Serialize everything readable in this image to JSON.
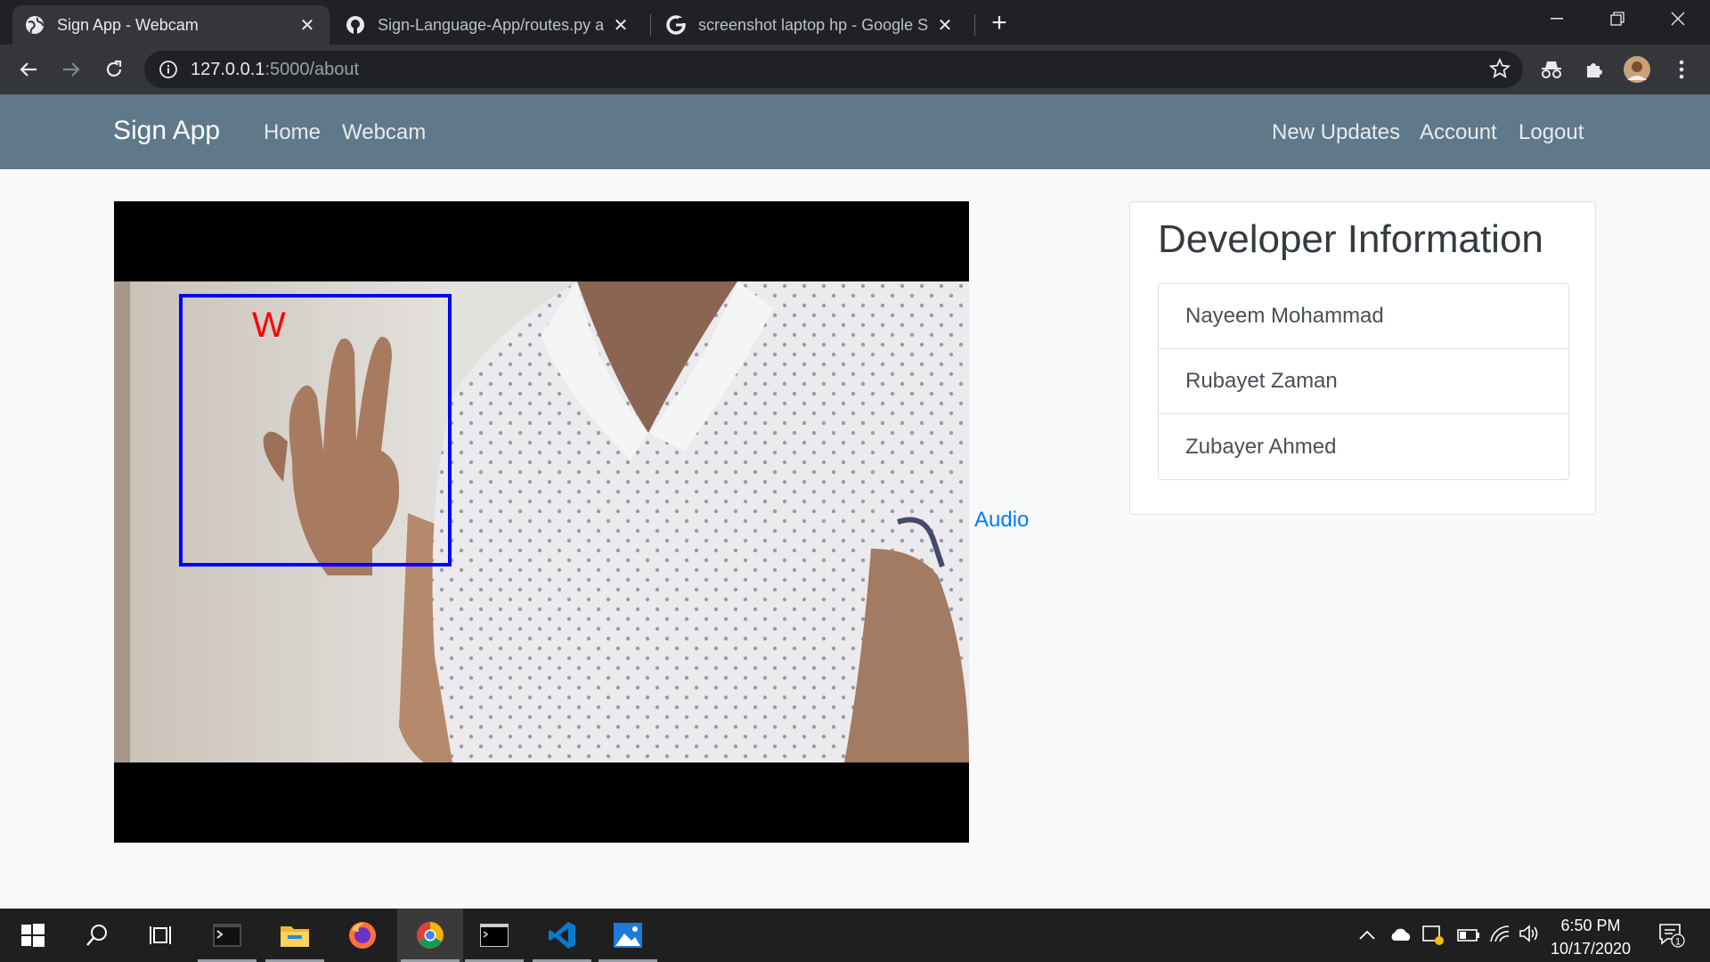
{
  "browser": {
    "tabs": [
      {
        "title": "Sign App - Webcam",
        "icon": "globe-icon",
        "active": true
      },
      {
        "title": "Sign-Language-App/routes.py at",
        "icon": "github-icon",
        "active": false
      },
      {
        "title": "screenshot laptop hp - Google S",
        "icon": "google-icon",
        "active": false
      }
    ],
    "close_glyph": "✕",
    "new_tab_glyph": "+",
    "url_host": "127.0.0.1",
    "url_path": ":5000/about"
  },
  "site": {
    "brand": "Sign App",
    "nav_left": [
      "Home",
      "Webcam"
    ],
    "nav_right": [
      "New Updates",
      "Account",
      "Logout"
    ],
    "colors": {
      "navbar": "#5f788a",
      "link": "#007bff"
    }
  },
  "webcam": {
    "detected_letter": "W",
    "box_color": "#0000ff",
    "letter_color": "#ff0000"
  },
  "audio_link": "Audio",
  "developer_card": {
    "title": "Developer Information",
    "developers": [
      "Nayeem Mohammad",
      "Rubayet Zaman",
      "Zubayer Ahmed"
    ]
  },
  "taskbar": {
    "apps": [
      "start-icon",
      "search-icon",
      "task-view-icon",
      "terminal-icon",
      "file-explorer-icon",
      "firefox-icon",
      "chrome-icon",
      "cmd-icon",
      "vscode-icon",
      "photos-icon"
    ],
    "time": "6:50 PM",
    "date": "10/17/2020",
    "notification_count": "1"
  }
}
